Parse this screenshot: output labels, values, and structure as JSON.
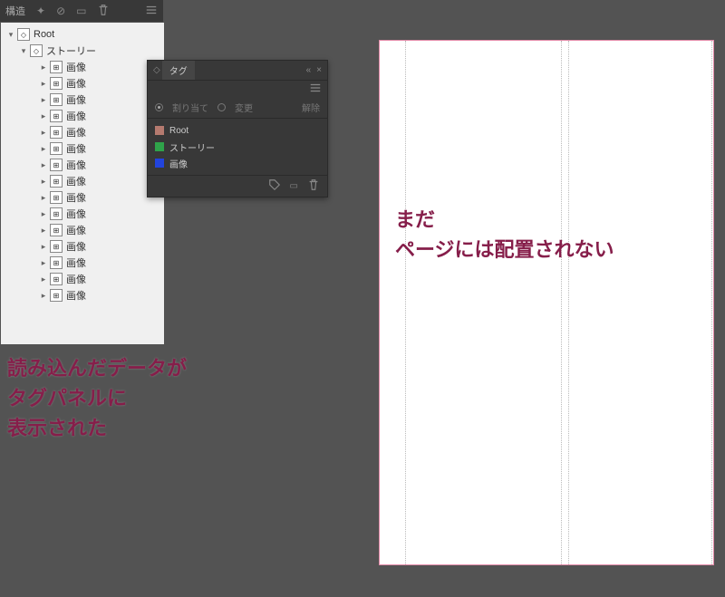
{
  "structure_panel": {
    "title": "構造",
    "root_label": "Root",
    "story_label": "ストーリー",
    "image_label": "画像",
    "image_count": 15
  },
  "tag_panel": {
    "tab_label": "タグ",
    "assign_label": "割り当て",
    "retag_label": "変更",
    "release_label": "解除",
    "items": [
      {
        "label": "Root",
        "color": "#b57a6f"
      },
      {
        "label": "ストーリー",
        "color": "#2fa34a"
      },
      {
        "label": "画像",
        "color": "#2244dd"
      }
    ]
  },
  "annotations": {
    "left_line1": "読み込んだデータが",
    "left_line2": "タグパネルに",
    "left_line3": "表示された",
    "right_line1": "まだ",
    "right_line2": "ページには配置されない"
  }
}
